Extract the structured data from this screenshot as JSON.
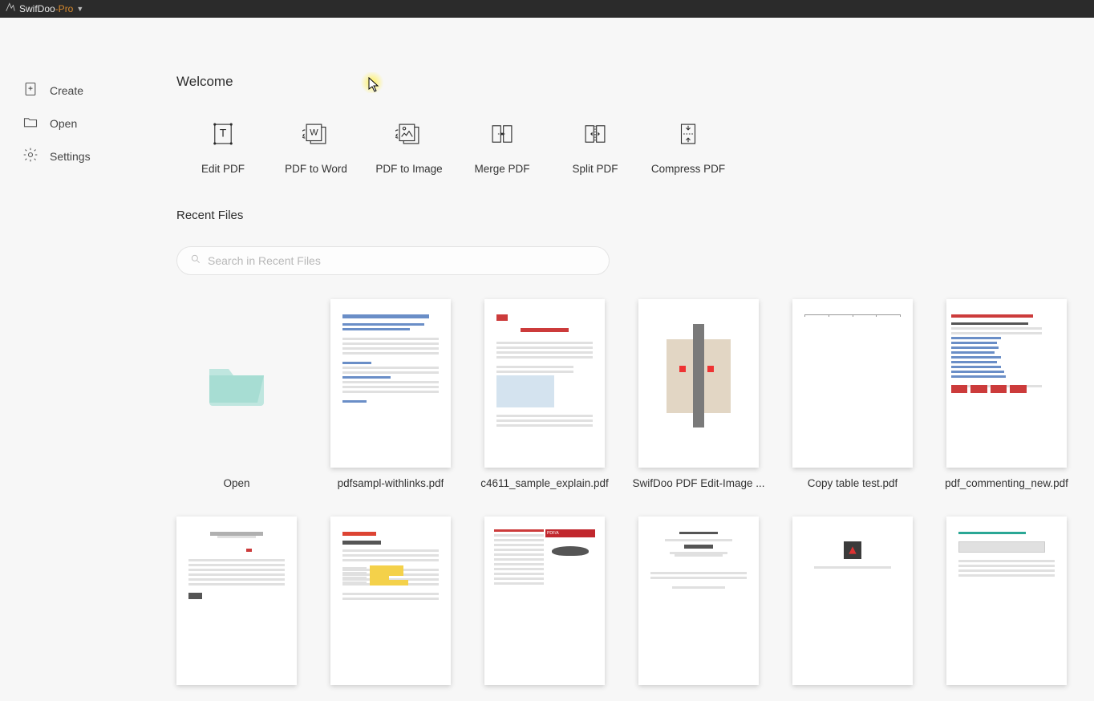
{
  "titlebar": {
    "brand_main": "SwifDoo",
    "brand_sub": "-Pro"
  },
  "sidebar": {
    "items": [
      {
        "id": "create",
        "label": "Create"
      },
      {
        "id": "open",
        "label": "Open"
      },
      {
        "id": "settings",
        "label": "Settings"
      }
    ]
  },
  "welcome_title": "Welcome",
  "actions": [
    {
      "id": "edit-pdf",
      "label": "Edit PDF"
    },
    {
      "id": "pdf-to-word",
      "label": "PDF to Word"
    },
    {
      "id": "pdf-to-image",
      "label": "PDF to Image"
    },
    {
      "id": "merge-pdf",
      "label": "Merge PDF"
    },
    {
      "id": "split-pdf",
      "label": "Split PDF"
    },
    {
      "id": "compress-pdf",
      "label": "Compress PDF"
    }
  ],
  "recent_title": "Recent Files",
  "search": {
    "placeholder": "Search in Recent Files"
  },
  "recent_files_row1": [
    {
      "id": "open-tile",
      "label": "Open",
      "is_open_tile": true
    },
    {
      "id": "f1",
      "label": "pdfsampl-withlinks.pdf"
    },
    {
      "id": "f2",
      "label": "c4611_sample_explain.pdf"
    },
    {
      "id": "f3",
      "label": "SwifDoo PDF   Edit-Image ..."
    },
    {
      "id": "f4",
      "label": "Copy table test.pdf"
    },
    {
      "id": "f5",
      "label": "pdf_commenting_new.pdf"
    }
  ],
  "recent_files_row2": [
    {
      "id": "f6"
    },
    {
      "id": "f7"
    },
    {
      "id": "f8"
    },
    {
      "id": "f9"
    },
    {
      "id": "f10"
    },
    {
      "id": "f11"
    }
  ]
}
